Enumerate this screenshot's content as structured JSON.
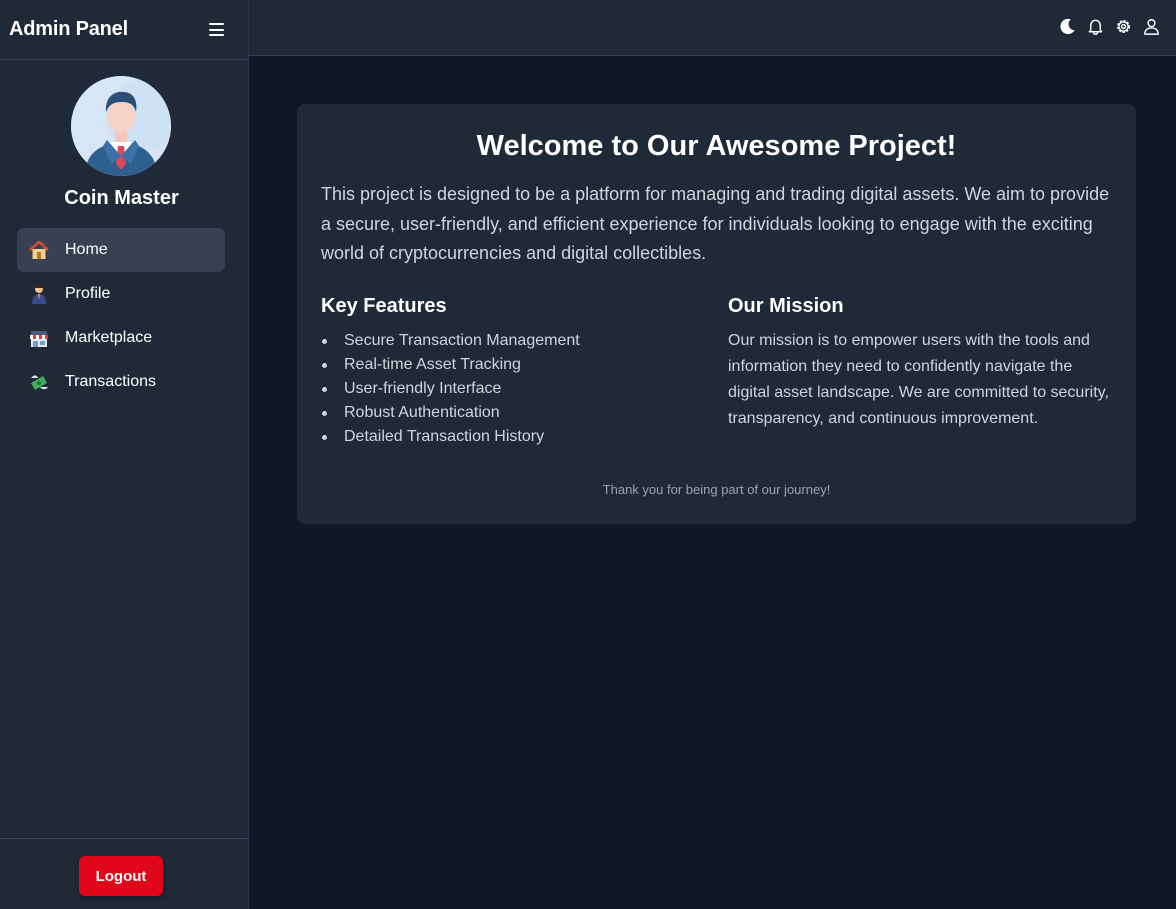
{
  "sidebar": {
    "title": "Admin Panel",
    "menu_icon": "hamburger-icon",
    "username": "Coin Master",
    "avatar": "businessman-avatar",
    "items": [
      {
        "label": "Home",
        "icon": "house-icon",
        "active": true
      },
      {
        "label": "Profile",
        "icon": "person-icon",
        "active": false
      },
      {
        "label": "Marketplace",
        "icon": "store-icon",
        "active": false
      },
      {
        "label": "Transactions",
        "icon": "money-wings-icon",
        "active": false
      }
    ],
    "logout_label": "Logout"
  },
  "topbar": {
    "icons": [
      "moon-icon",
      "bell-icon",
      "gear-icon",
      "user-icon"
    ]
  },
  "main": {
    "title": "Welcome to Our Awesome Project!",
    "intro": "This project is designed to be a platform for managing and trading digital assets. We aim to provide a secure, user-friendly, and efficient experience for individuals looking to engage with the exciting world of cryptocurrencies and digital collectibles.",
    "features_title": "Key Features",
    "features": [
      "Secure Transaction Management",
      "Real-time Asset Tracking",
      "User-friendly Interface",
      "Robust Authentication",
      "Detailed Transaction History"
    ],
    "mission_title": "Our Mission",
    "mission_text": "Our mission is to empower users with the tools and information they need to confidently navigate the digital asset landscape. We are committed to security, transparency, and continuous improvement.",
    "footer": "Thank you for being part of our journey!"
  },
  "colors": {
    "background": "#111827",
    "panel": "#1f2937",
    "active_item": "#374151",
    "logout": "#e1071a"
  }
}
